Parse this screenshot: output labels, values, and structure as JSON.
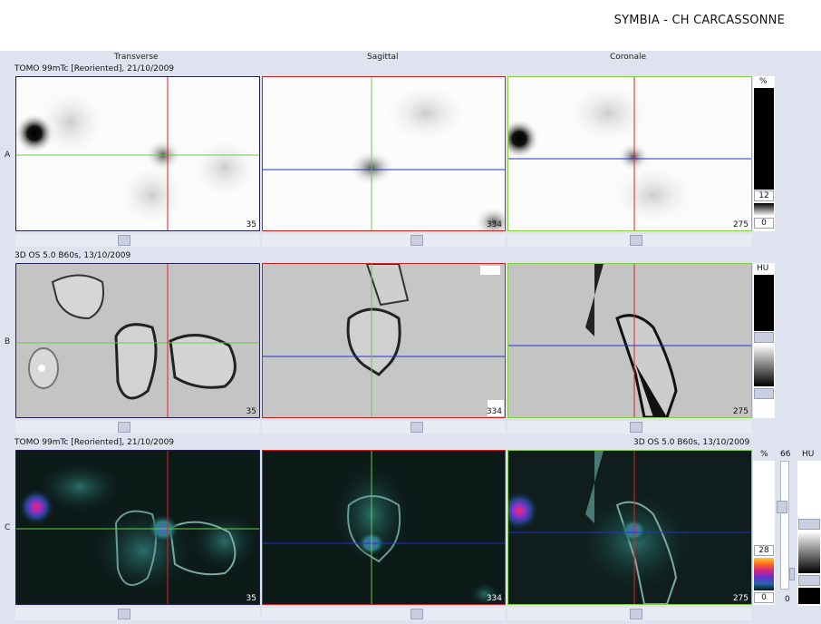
{
  "header": {
    "site_title": "SYMBIA - CH CARCASSONNE"
  },
  "columns": [
    "Transverse",
    "Sagittal",
    "Coronale"
  ],
  "rows": [
    {
      "letter": "A",
      "info_left": "TOMO 99mTc [Reoriented], 21/10/2009",
      "info_right": ""
    },
    {
      "letter": "B",
      "info_left": "3D  OS  5.0  B60s, 13/10/2009",
      "info_right": ""
    },
    {
      "letter": "C",
      "info_left": "TOMO 99mTc [Reoriented], 21/10/2009",
      "info_right": "3D  OS  5.0  B60s, 13/10/2009"
    }
  ],
  "slice_numbers": {
    "transverse": "35",
    "sagittal": "334",
    "coronale": "275"
  },
  "scales": {
    "a": {
      "unit": "%",
      "value_top": "12",
      "value_bottom": "0"
    },
    "b": {
      "unit": "HU"
    },
    "c": {
      "unit": "%",
      "value_top": "28",
      "value_bottom": "0",
      "blend": "66",
      "blend_bottom": "0",
      "unit2": "HU"
    }
  },
  "colors": {
    "transverse_border": "#22224a",
    "sagittal_border": "#cc2222",
    "coronale_border": "#88cc44",
    "crosshair_red": "#dd2222",
    "crosshair_green": "#66cc44",
    "crosshair_blue": "#2233cc"
  }
}
